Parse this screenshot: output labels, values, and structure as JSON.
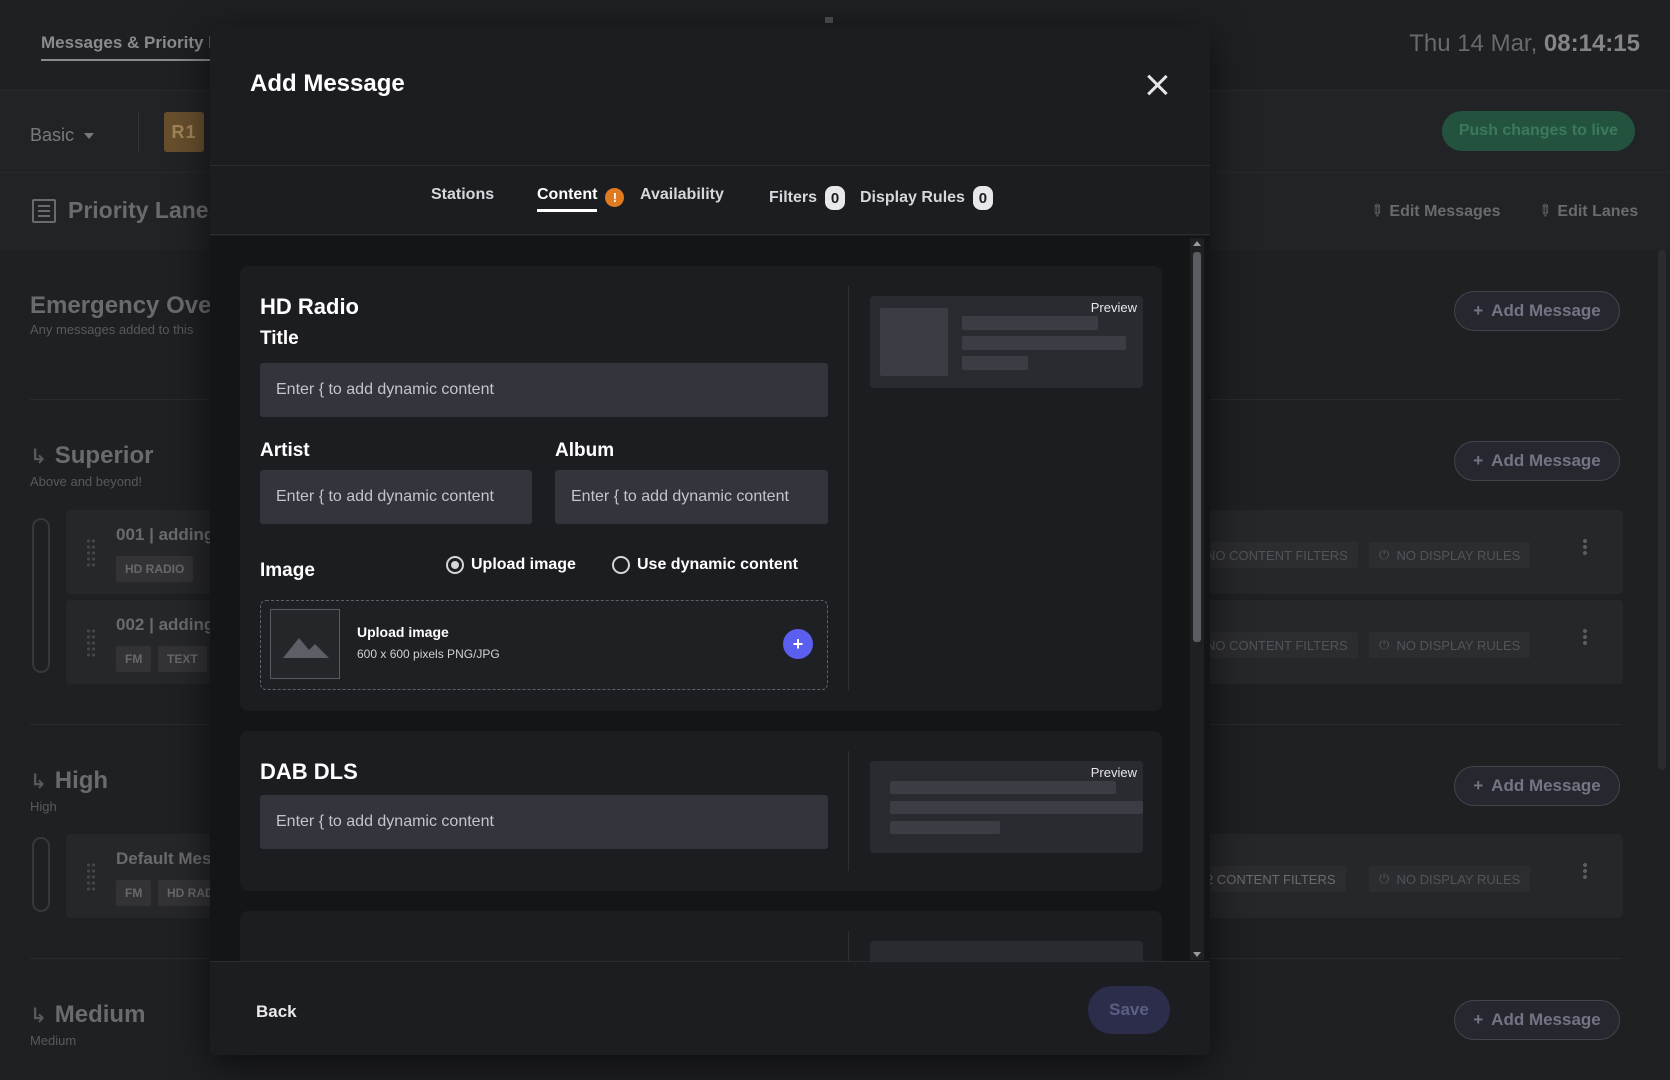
{
  "app": {
    "tab_label": "Messages & Priority l",
    "clock_date": "Thu 14 Mar,",
    "clock_time": "08:14:15",
    "mode_select": "Basic",
    "station_badge": "R1",
    "push_button": "Push changes to live",
    "lanes_title": "Priority Lanes",
    "edit_messages": "Edit Messages",
    "edit_lanes": "Edit Lanes",
    "add_message_label": "Add Message",
    "sections": {
      "emergency": {
        "title": "Emergency Over",
        "subtitle": "Any messages added to this"
      },
      "superior": {
        "title": "Superior",
        "subtitle": "Above and beyond!"
      },
      "high": {
        "title": "High",
        "subtitle": "High"
      },
      "medium": {
        "title": "Medium",
        "subtitle": "Medium"
      }
    },
    "cards": [
      {
        "title": "001 | adding",
        "tags": [
          "HD RADIO"
        ],
        "filters": "NO CONTENT FILTERS",
        "rules": "NO DISPLAY RULES"
      },
      {
        "title": "002 | adding",
        "tags": [
          "FM",
          "TEXT"
        ],
        "filters": "NO CONTENT FILTERS",
        "rules": "NO DISPLAY RULES"
      },
      {
        "title": "Default Mes",
        "tags": [
          "FM",
          "HD RAD"
        ],
        "filters": "2 CONTENT FILTERS",
        "rules": "NO DISPLAY RULES"
      }
    ]
  },
  "modal": {
    "title": "Add Message",
    "tabs": [
      {
        "label": "Stations"
      },
      {
        "label": "Content",
        "warning": "!"
      },
      {
        "label": "Availability"
      },
      {
        "label": "Filters",
        "count": "0"
      },
      {
        "label": "Display Rules",
        "count": "0"
      }
    ],
    "hd_radio": {
      "heading": "HD Radio",
      "title_label": "Title",
      "title_placeholder": "Enter { to add dynamic content",
      "artist_label": "Artist",
      "artist_placeholder": "Enter { to add dynamic content",
      "album_label": "Album",
      "album_placeholder": "Enter { to add dynamic content",
      "image_label": "Image",
      "radio_upload": "Upload image",
      "radio_dynamic": "Use dynamic content",
      "upload_title": "Upload image",
      "upload_sub": "600 x 600 pixels PNG/JPG",
      "preview_label": "Preview"
    },
    "dab_dls": {
      "heading": "DAB DLS",
      "placeholder": "Enter { to add dynamic content",
      "preview_label": "Preview"
    },
    "back_button": "Back",
    "save_button": "Save"
  },
  "colors": {
    "accent": "#5b5ff0",
    "warning": "#e07a1f",
    "push_green": "#2f6f55"
  }
}
